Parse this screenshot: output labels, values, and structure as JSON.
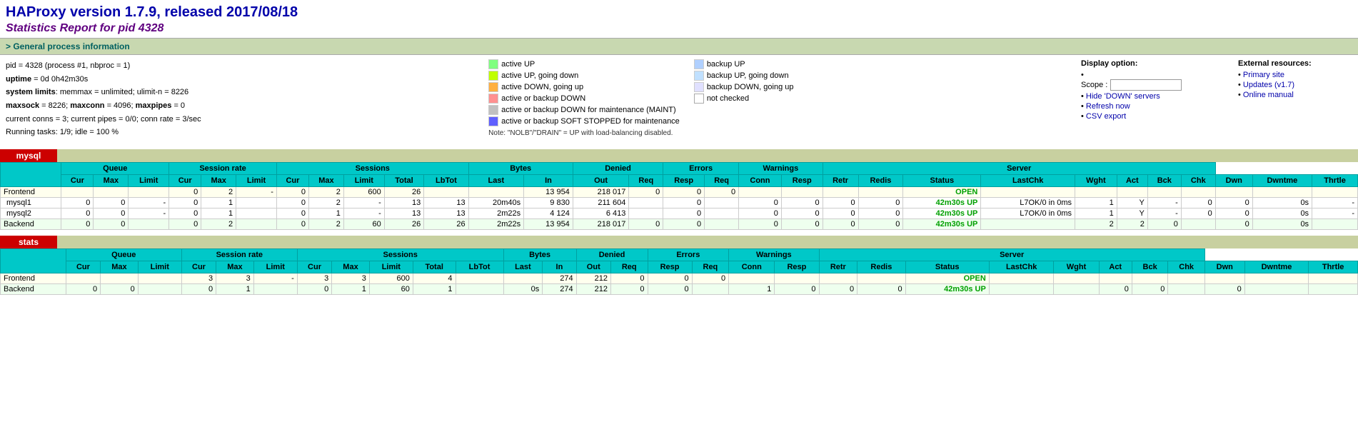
{
  "header": {
    "title": "HAProxy version 1.7.9, released 2017/08/18",
    "subtitle": "Statistics Report for pid 4328"
  },
  "general_section_label": "> General process information",
  "sysinfo": {
    "pid_line": "pid = 4328 (process #1, nbproc = 1)",
    "uptime_line": "uptime = 0d 0h42m30s",
    "syslimits_line": "system limits: memmax = unlimited; ulimit-n = 8226",
    "maxsock_line": "maxsock = 8226; maxconn = 4096; maxpipes = 0",
    "conns_line": "current conns = 3; current pipes = 0/0; conn rate = 3/sec",
    "tasks_line": "Running tasks: 1/9; idle = 100 %"
  },
  "legend": {
    "left_col": [
      {
        "color": "#80ff80",
        "label": "active UP"
      },
      {
        "color": "#c0ff00",
        "label": "active UP, going down"
      },
      {
        "color": "#ffb040",
        "label": "active DOWN, going up"
      },
      {
        "color": "#ff9090",
        "label": "active or backup DOWN"
      },
      {
        "color": "#c0c0c0",
        "label": "active or backup DOWN for maintenance (MAINT)"
      },
      {
        "color": "#6060ff",
        "label": "active or backup SOFT STOPPED for maintenance"
      }
    ],
    "right_col": [
      {
        "color": "#b0d0ff",
        "label": "backup UP"
      },
      {
        "color": "#c0e0ff",
        "label": "backup UP, going down"
      },
      {
        "color": "#e0e0ff",
        "label": "backup DOWN, going up"
      },
      {
        "color": "#ffffff",
        "label": "not checked"
      }
    ],
    "note": "Note: \"NOLB\"/\"DRAIN\" = UP with load-balancing disabled."
  },
  "display_options": {
    "title": "Display option:",
    "scope_label": "Scope :",
    "links": [
      {
        "label": "Hide 'DOWN' servers",
        "href": "#"
      },
      {
        "label": "Refresh now",
        "href": "#"
      },
      {
        "label": "CSV export",
        "href": "#"
      }
    ]
  },
  "ext_resources": {
    "title": "External resources:",
    "links": [
      {
        "label": "Primary site",
        "href": "#"
      },
      {
        "label": "Updates (v1.7)",
        "href": "#"
      },
      {
        "label": "Online manual",
        "href": "#"
      }
    ]
  },
  "proxies": [
    {
      "name": "mysql",
      "color": "#c00",
      "col_groups": [
        "Queue",
        "Session rate",
        "Sessions",
        "Bytes",
        "Denied",
        "Errors",
        "Warnings",
        "Server"
      ],
      "col_group_spans": [
        3,
        3,
        5,
        2,
        2,
        2,
        2,
        6
      ],
      "col_headers": [
        "Cur",
        "Max",
        "Limit",
        "Cur",
        "Max",
        "Limit",
        "Cur",
        "Max",
        "Limit",
        "Total",
        "LbTot",
        "Last",
        "In",
        "Out",
        "Req",
        "Resp",
        "Req",
        "Conn",
        "Resp",
        "Retr",
        "Redis",
        "Status",
        "LastChk",
        "Wght",
        "Act",
        "Bck",
        "Chk",
        "Dwn",
        "Dwntme",
        "Thrtle"
      ],
      "rows": [
        {
          "type": "frontend",
          "name": "Frontend",
          "cells": [
            "",
            "",
            "",
            "0",
            "2",
            "-",
            "0",
            "2",
            "600",
            "26",
            "",
            "",
            "13 954",
            "218 017",
            "0",
            "0",
            "0",
            "",
            "",
            "",
            "",
            "OPEN",
            "",
            "",
            "",
            "",
            "",
            "",
            "",
            ""
          ]
        },
        {
          "type": "server",
          "name": "mysql1",
          "cells": [
            "0",
            "0",
            "-",
            "0",
            "1",
            "",
            "0",
            "2",
            "-",
            "13",
            "13",
            "20m40s",
            "9 830",
            "211 604",
            "",
            "0",
            "",
            "0",
            "0",
            "0",
            "0",
            "42m30s UP",
            "L7OK/0 in 0ms",
            "1",
            "Y",
            "-",
            "0",
            "0",
            "0s",
            "-"
          ]
        },
        {
          "type": "server",
          "name": "mysql2",
          "cells": [
            "0",
            "0",
            "-",
            "0",
            "1",
            "",
            "0",
            "1",
            "-",
            "13",
            "13",
            "2m22s",
            "4 124",
            "6 413",
            "",
            "0",
            "",
            "0",
            "0",
            "0",
            "0",
            "42m30s UP",
            "L7OK/0 in 0ms",
            "1",
            "Y",
            "-",
            "0",
            "0",
            "0s",
            "-"
          ]
        },
        {
          "type": "backend",
          "name": "Backend",
          "cells": [
            "0",
            "0",
            "",
            "0",
            "2",
            "",
            "0",
            "2",
            "60",
            "26",
            "26",
            "2m22s",
            "13 954",
            "218 017",
            "0",
            "0",
            "",
            "0",
            "0",
            "0",
            "0",
            "42m30s UP",
            "",
            "2",
            "2",
            "0",
            "",
            "0",
            "0s",
            ""
          ]
        }
      ]
    },
    {
      "name": "stats",
      "color": "#c00",
      "col_groups": [
        "Queue",
        "Session rate",
        "Sessions",
        "Bytes",
        "Denied",
        "Errors",
        "Warnings",
        "Server"
      ],
      "col_group_spans": [
        3,
        3,
        5,
        2,
        2,
        2,
        2,
        6
      ],
      "col_headers": [
        "Cur",
        "Max",
        "Limit",
        "Cur",
        "Max",
        "Limit",
        "Cur",
        "Max",
        "Limit",
        "Total",
        "LbTot",
        "Last",
        "In",
        "Out",
        "Req",
        "Resp",
        "Req",
        "Conn",
        "Resp",
        "Retr",
        "Redis",
        "Status",
        "LastChk",
        "Wght",
        "Act",
        "Bck",
        "Chk",
        "Dwn",
        "Dwntme",
        "Thrtle"
      ],
      "rows": [
        {
          "type": "frontend",
          "name": "Frontend",
          "cells": [
            "",
            "",
            "",
            "3",
            "3",
            "-",
            "3",
            "3",
            "600",
            "4",
            "",
            "",
            "274",
            "212",
            "0",
            "0",
            "0",
            "",
            "",
            "",
            "",
            "OPEN",
            "",
            "",
            "",
            "",
            "",
            "",
            "",
            ""
          ]
        },
        {
          "type": "backend",
          "name": "Backend",
          "cells": [
            "0",
            "0",
            "",
            "0",
            "1",
            "",
            "0",
            "1",
            "60",
            "1",
            "",
            "0s",
            "274",
            "212",
            "0",
            "0",
            "",
            "1",
            "0",
            "0",
            "0",
            "42m30s UP",
            "",
            "",
            "0",
            "0",
            "",
            "0",
            "",
            ""
          ]
        }
      ]
    }
  ]
}
